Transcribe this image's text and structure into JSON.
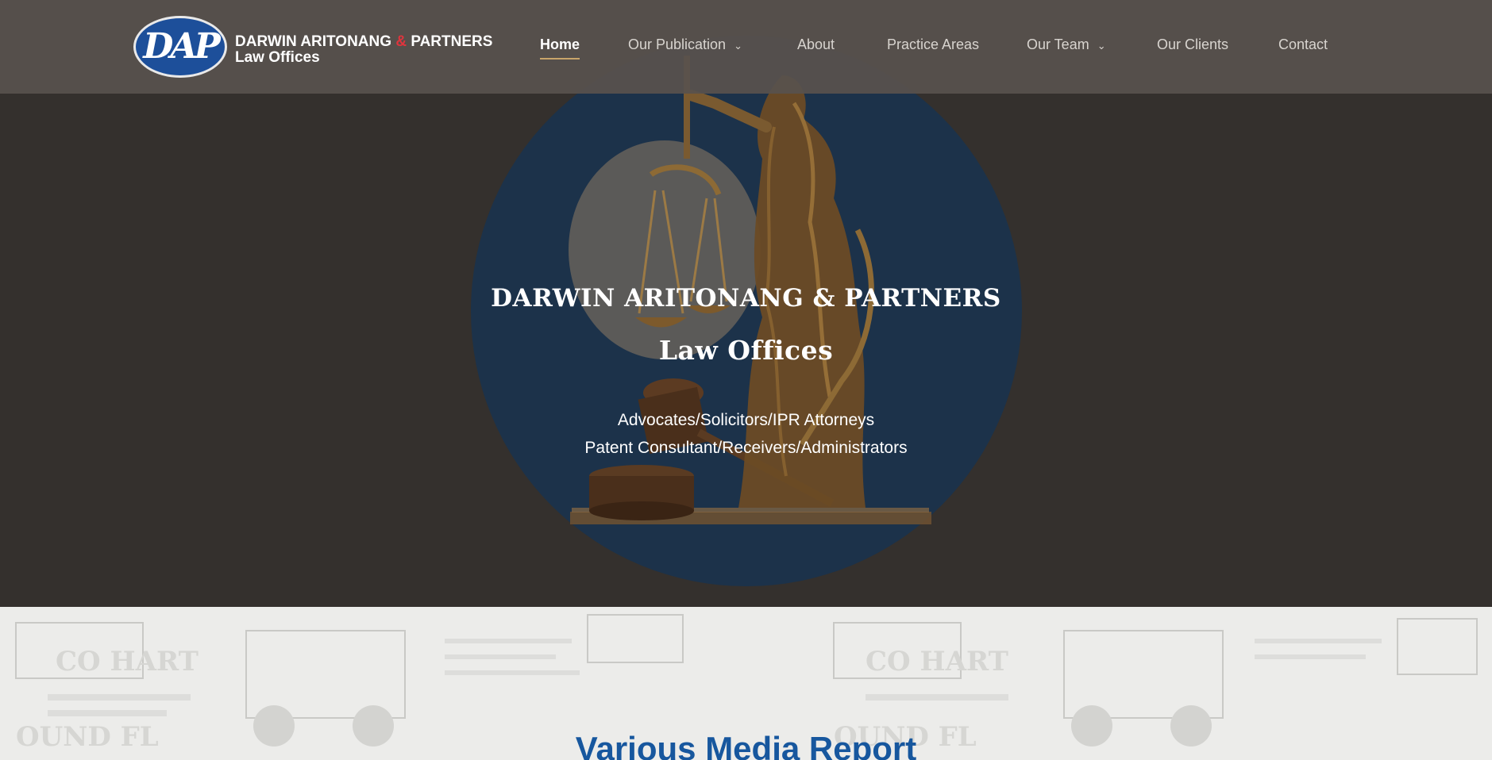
{
  "brand": {
    "badge_text": "DAP",
    "name_part1": "DARWIN ARITONANG ",
    "name_amp": "&",
    "name_part2": " PARTNERS",
    "subtitle": "Law Offices",
    "amp_color": "#e0343d"
  },
  "nav": {
    "items": [
      {
        "label": "Home",
        "active": true
      },
      {
        "label": "Our Publication",
        "has_dropdown": true
      },
      {
        "label": "About"
      },
      {
        "label": "Practice Areas"
      },
      {
        "label": "Our Team",
        "has_dropdown": true
      },
      {
        "label": "Our Clients"
      },
      {
        "label": "Contact"
      }
    ],
    "dropdown_icon": "chevron-down-icon",
    "active_underline_color": "#c8a46a"
  },
  "hero": {
    "title_line1": "DARWIN ARITONANG & PARTNERS",
    "title_line2": "Law Offices",
    "subtitle_line1": "Advocates/Solicitors/IPR Attorneys",
    "subtitle_line2": "Patent Consultant/Receivers/Administrators",
    "image": "lady-justice-statue-with-scales-and-gavel",
    "circle_color": "#1c324a"
  },
  "media": {
    "title": "Various Media Report",
    "title_color": "#17579e",
    "background": "newspaper-collage"
  }
}
